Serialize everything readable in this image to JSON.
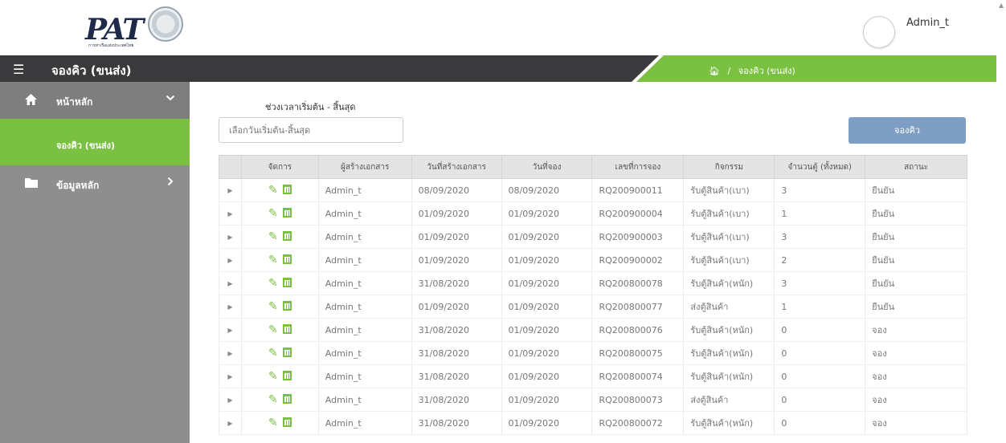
{
  "header": {
    "logo_text": "PAT",
    "logo_sub": "การท่าเรือแห่งประเทศไทย",
    "username": "Admin_t"
  },
  "navbar": {
    "title": "จองคิว (ขนส่ง)",
    "breadcrumb_sep": "/",
    "breadcrumb_current": "จองคิว (ขนส่ง)"
  },
  "sidebar": {
    "items": [
      {
        "label": "หน้าหลัก",
        "icon": "home-icon"
      },
      {
        "label": "จองคิว (ขนส่ง)"
      },
      {
        "label": "ข้อมูลหลัก",
        "icon": "folder-icon"
      }
    ]
  },
  "main": {
    "range_label": "ช่วงเวลาเริ่มต้น - สิ้นสุด",
    "range_placeholder": "เลือกวันเริ่มต้น-สิ้นสุด",
    "book_button": "จองคิว"
  },
  "table": {
    "columns": [
      "จัดการ",
      "ผู้สร้างเอกสาร",
      "วันที่สร้างเอกสาร",
      "วันที่จอง",
      "เลขที่การจอง",
      "กิจกรรม",
      "จำนวนตู้ (ทั้งหมด)",
      "สถานะ"
    ],
    "rows": [
      [
        "Admin_t",
        "08/09/2020",
        "08/09/2020",
        "RQ200900011",
        "รับตู้สินค้า(เบา)",
        "3",
        "ยืนยัน"
      ],
      [
        "Admin_t",
        "01/09/2020",
        "01/09/2020",
        "RQ200900004",
        "รับตู้สินค้า(เบา)",
        "1",
        "ยืนยัน"
      ],
      [
        "Admin_t",
        "01/09/2020",
        "01/09/2020",
        "RQ200900003",
        "รับตู้สินค้า(เบา)",
        "3",
        "ยืนยัน"
      ],
      [
        "Admin_t",
        "01/09/2020",
        "01/09/2020",
        "RQ200900002",
        "รับตู้สินค้า(เบา)",
        "2",
        "ยืนยัน"
      ],
      [
        "Admin_t",
        "31/08/2020",
        "01/09/2020",
        "RQ200800078",
        "รับตู้สินค้า(หนัก)",
        "3",
        "ยืนยัน"
      ],
      [
        "Admin_t",
        "01/09/2020",
        "01/09/2020",
        "RQ200800077",
        "ส่งตู้สินค้า",
        "1",
        "ยืนยัน"
      ],
      [
        "Admin_t",
        "31/08/2020",
        "01/09/2020",
        "RQ200800076",
        "รับตู้สินค้า(หนัก)",
        "0",
        "จอง"
      ],
      [
        "Admin_t",
        "31/08/2020",
        "01/09/2020",
        "RQ200800075",
        "รับตู้สินค้า(หนัก)",
        "0",
        "จอง"
      ],
      [
        "Admin_t",
        "31/08/2020",
        "01/09/2020",
        "RQ200800074",
        "รับตู้สินค้า(หนัก)",
        "0",
        "จอง"
      ],
      [
        "Admin_t",
        "31/08/2020",
        "01/09/2020",
        "RQ200800073",
        "ส่งตู้สินค้า",
        "0",
        "จอง"
      ],
      [
        "Admin_t",
        "31/08/2020",
        "01/09/2020",
        "RQ200800072",
        "รับตู้สินค้า(หนัก)",
        "0",
        "จอง"
      ]
    ]
  },
  "colors": {
    "accent_green": "#7ac142",
    "navbar_dark": "#3a3a3d",
    "sidebar_gray": "#8e8e8e",
    "button_blue": "#7f9ec4"
  }
}
